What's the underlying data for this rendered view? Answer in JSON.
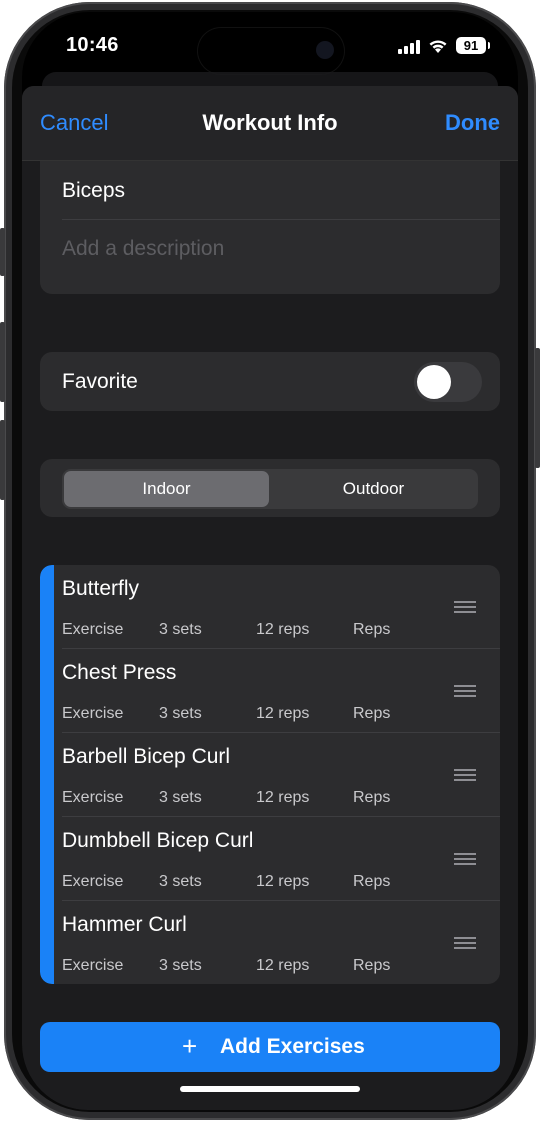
{
  "status_bar": {
    "time": "10:46",
    "battery": "91"
  },
  "nav": {
    "cancel": "Cancel",
    "title": "Workout Info",
    "done": "Done"
  },
  "workout": {
    "name": "Biceps",
    "description_placeholder": "Add a description"
  },
  "favorite": {
    "label": "Favorite",
    "on": false
  },
  "location": {
    "options": [
      "Indoor",
      "Outdoor"
    ],
    "selected": "Indoor"
  },
  "exercises": [
    {
      "name": "Butterfly",
      "type": "Exercise",
      "sets": "3 sets",
      "reps": "12 reps",
      "mode": "Reps"
    },
    {
      "name": "Chest Press",
      "type": "Exercise",
      "sets": "3 sets",
      "reps": "12 reps",
      "mode": "Reps"
    },
    {
      "name": "Barbell Bicep Curl",
      "type": "Exercise",
      "sets": "3 sets",
      "reps": "12 reps",
      "mode": "Reps"
    },
    {
      "name": "Dumbbell Bicep Curl",
      "type": "Exercise",
      "sets": "3 sets",
      "reps": "12 reps",
      "mode": "Reps"
    },
    {
      "name": "Hammer Curl",
      "type": "Exercise",
      "sets": "3 sets",
      "reps": "12 reps",
      "mode": "Reps"
    }
  ],
  "add_button": {
    "label": "Add Exercises",
    "icon": "plus-icon"
  },
  "colors": {
    "accent": "#1a82f7",
    "link": "#2f8cff",
    "background": "#1c1c1e",
    "card": "#2c2c2e"
  }
}
